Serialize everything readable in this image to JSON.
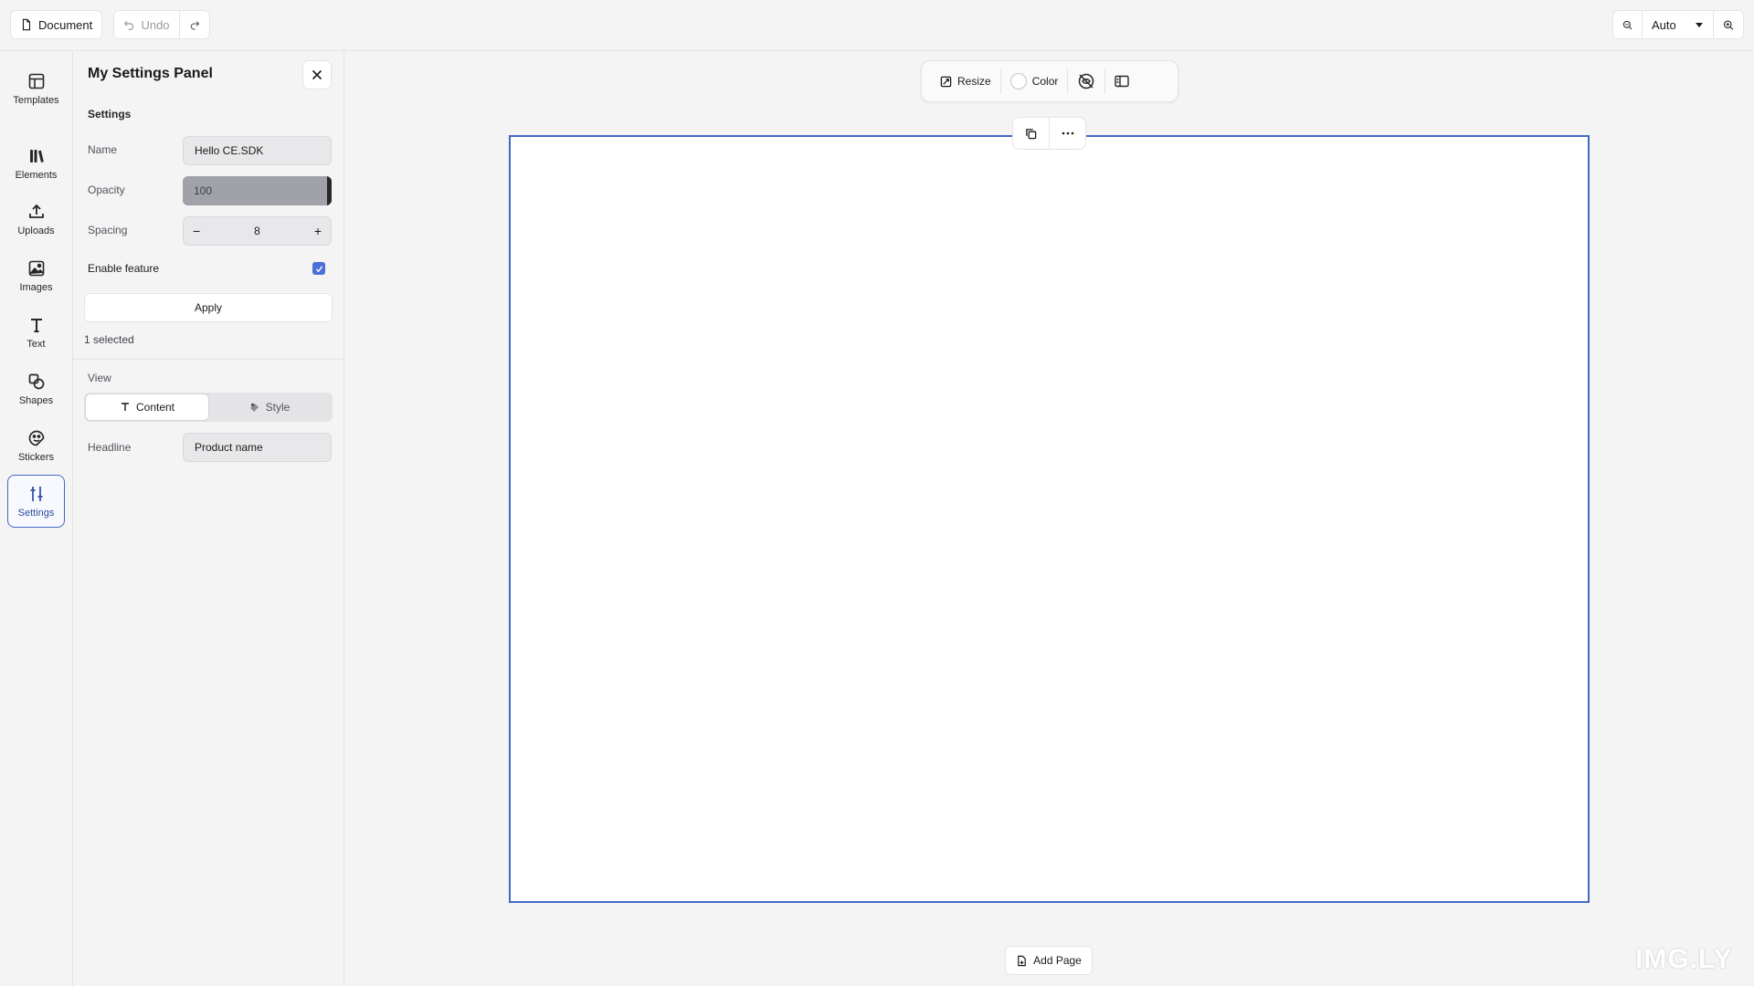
{
  "topbar": {
    "document_label": "Document",
    "undo_label": "Undo",
    "zoom_value": "Auto"
  },
  "rail": {
    "items": [
      {
        "label": "Templates"
      },
      {
        "label": "Elements"
      },
      {
        "label": "Uploads"
      },
      {
        "label": "Images"
      },
      {
        "label": "Text"
      },
      {
        "label": "Shapes"
      },
      {
        "label": "Stickers"
      },
      {
        "label": "Settings"
      }
    ]
  },
  "panel": {
    "title": "My Settings Panel",
    "section_settings": "Settings",
    "name_label": "Name",
    "name_value": "Hello CE.SDK",
    "opacity_label": "Opacity",
    "opacity_value": "100",
    "spacing_label": "Spacing",
    "spacing_value": "8",
    "enable_label": "Enable feature",
    "enable_checked": true,
    "apply_label": "Apply",
    "selected_text": "1 selected",
    "view_label": "View",
    "view_tabs": [
      {
        "label": "Content"
      },
      {
        "label": "Style"
      }
    ],
    "headline_label": "Headline",
    "headline_value": "Product name"
  },
  "canvas_toolbar": {
    "resize_label": "Resize",
    "color_label": "Color"
  },
  "canvas": {
    "add_page_label": "Add Page",
    "accent_color": "#4468c4"
  },
  "watermark": "IMG.LY"
}
